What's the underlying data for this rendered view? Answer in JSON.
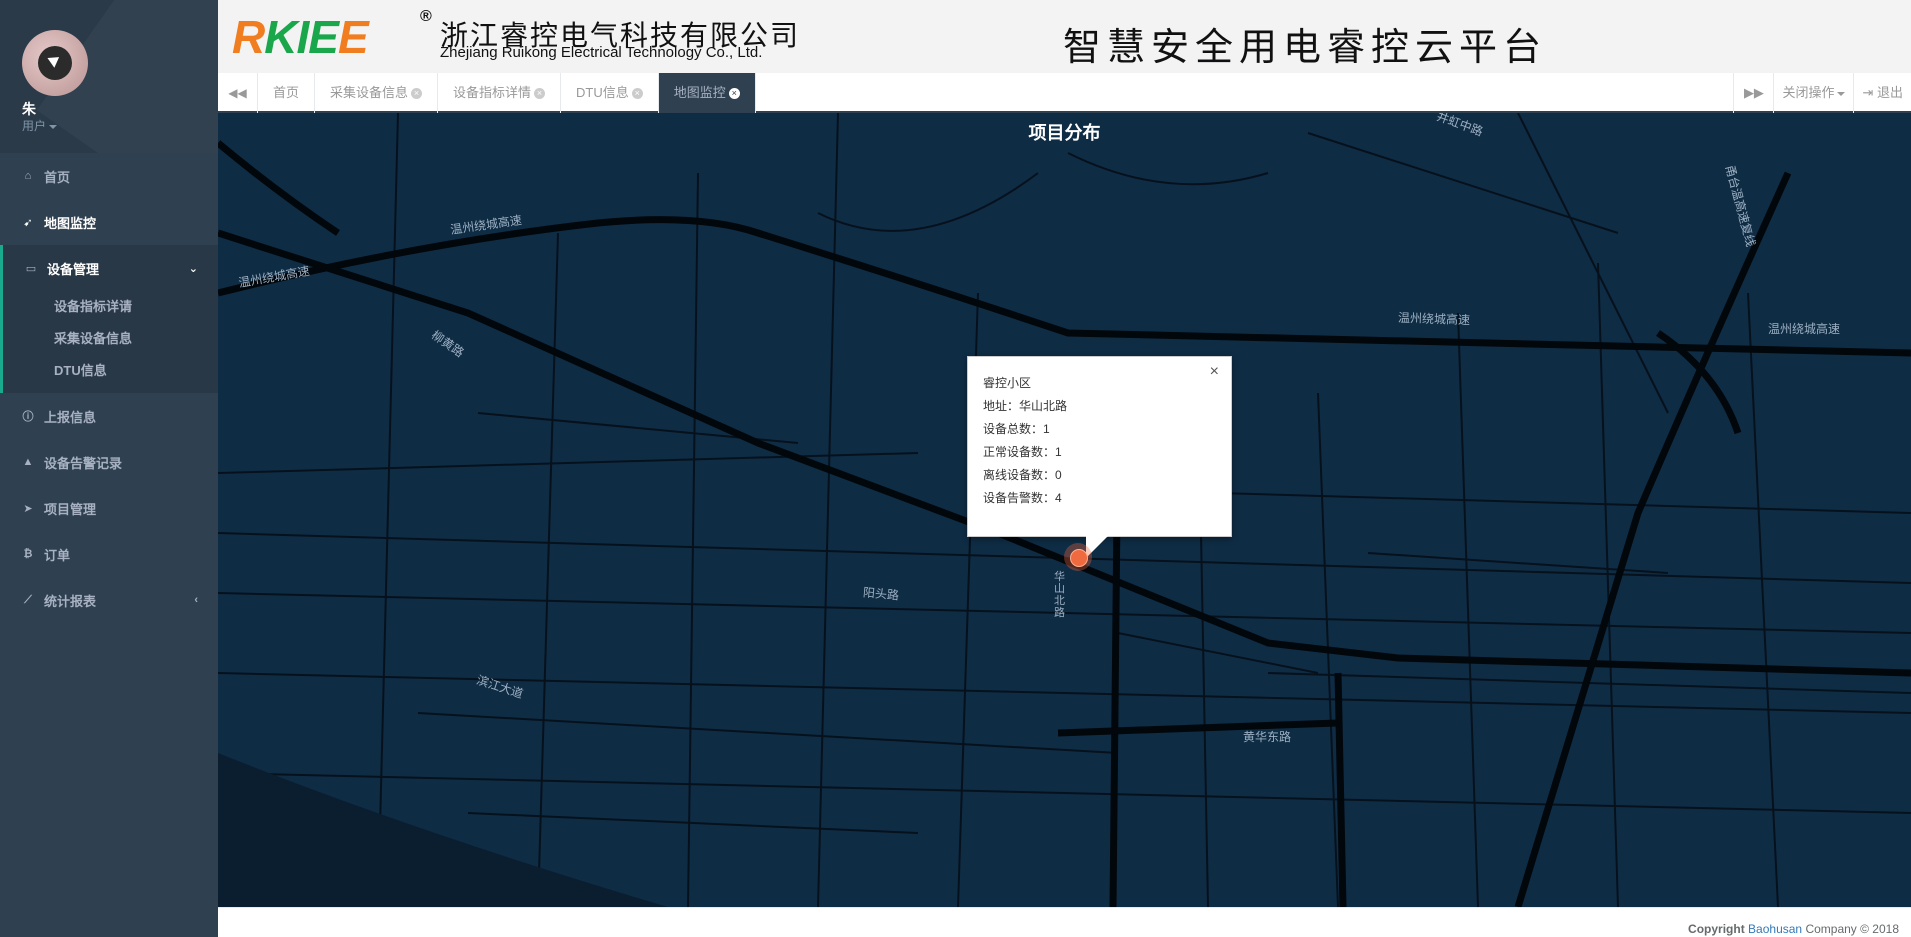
{
  "profile": {
    "name": "朱",
    "role": "用户"
  },
  "nav": {
    "home": "首页",
    "map_monitor": "地图监控",
    "device_mgmt": "设备管理",
    "device_sub": [
      "设备指标详请",
      "采集设备信息",
      "DTU信息"
    ],
    "report_info": "上报信息",
    "alarm_records": "设备告警记录",
    "project_mgmt": "项目管理",
    "orders": "订单",
    "statistics": "统计报表"
  },
  "header": {
    "logo_letters": [
      "R",
      "K",
      "I",
      "E",
      "E"
    ],
    "logo_reg": "®",
    "company_cn": "浙江睿控电气科技有限公司",
    "company_en": "Zhejiang Ruikong Electrical Technology Co., Ltd.",
    "platform_title": "智慧安全用电睿控云平台"
  },
  "tabs": [
    {
      "label": "首页",
      "closable": false,
      "active": false
    },
    {
      "label": "采集设备信息",
      "closable": true,
      "active": false
    },
    {
      "label": "设备指标详情",
      "closable": true,
      "active": false
    },
    {
      "label": "DTU信息",
      "closable": true,
      "active": false
    },
    {
      "label": "地图监控",
      "closable": true,
      "active": true
    }
  ],
  "tab_actions": {
    "close_ops": "关闭操作",
    "logout": "退出"
  },
  "map": {
    "title": "项目分布",
    "road_labels": [
      "温州绕城高速",
      "温州绕城高速",
      "温州绕城高速",
      "温州绕城高速",
      "柳黄路",
      "井虹中路",
      "甬台温高速复线",
      "阳头路",
      "滨江大道",
      "黄华东路",
      "华山北路"
    ],
    "popup": {
      "name": "睿控小区",
      "address": "地址：华山北路",
      "device_total": "设备总数：1",
      "normal_devices": "正常设备数：1",
      "offline_devices": "离线设备数：0",
      "alarm_devices": "设备告警数：4",
      "close": "×"
    }
  },
  "footer": {
    "copyright": "Copyright",
    "company_link": "Baohusan",
    "suffix": "Company © 2018"
  },
  "colors": {
    "sidebar": "#2f4050",
    "map_bg": "#0f2c45",
    "accent": "#19aa8d",
    "marker": "#f06a3f",
    "logo_orange": "#f07d1f",
    "logo_green": "#1aa64a"
  }
}
